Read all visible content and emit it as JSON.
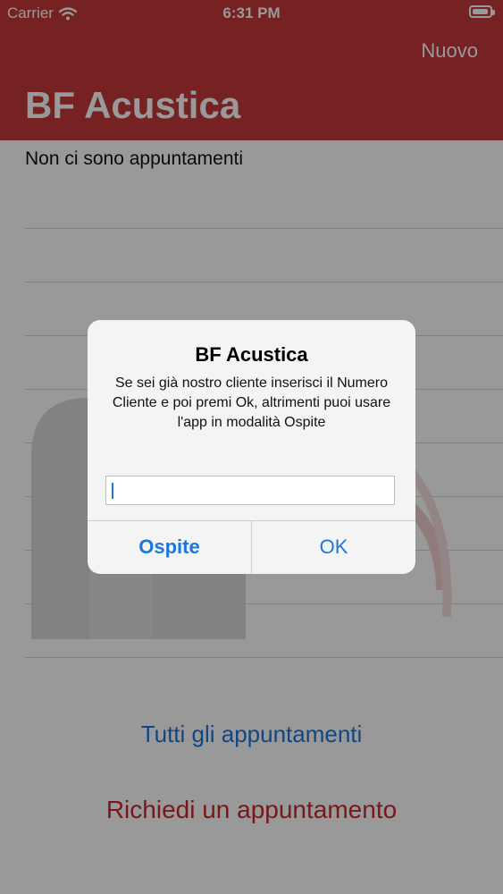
{
  "status_bar": {
    "carrier": "Carrier",
    "time": "6:31 PM",
    "battery_level": 0.95
  },
  "nav": {
    "new_label": "Nuovo",
    "title": "BF Acustica"
  },
  "content": {
    "empty_label": "Non ci sono appuntamenti"
  },
  "links": {
    "all_appointments": "Tutti gli appuntamenti",
    "request_appointment": "Richiedi un appuntamento"
  },
  "alert": {
    "title": "BF Acustica",
    "message": "Se sei già nostro cliente inserisci il Numero Cliente e poi premi Ok, altrimenti puoi usare l'app in modalità Ospite",
    "input_value": "",
    "guest_label": "Ospite",
    "ok_label": "OK"
  },
  "colors": {
    "brand_red": "#c5373a",
    "link_blue": "#1e76d8",
    "request_red": "#c9292d"
  },
  "icons": {
    "wifi": "wifi-icon",
    "battery": "battery-icon",
    "logo": "bf-acustica-logo"
  }
}
